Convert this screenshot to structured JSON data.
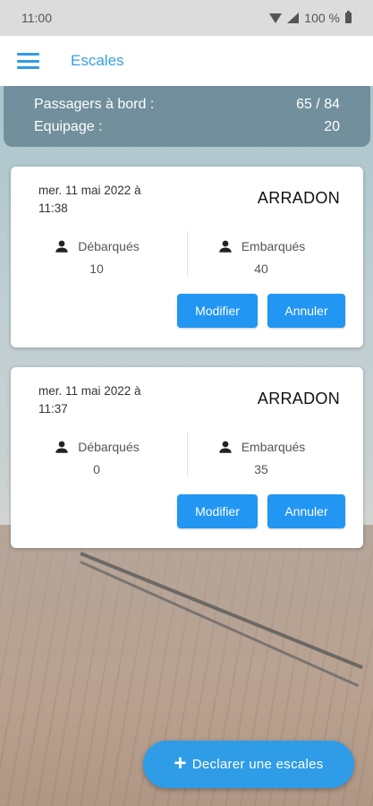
{
  "status_bar": {
    "time": "11:00",
    "battery": "100 %",
    "icons": [
      "wifi-icon",
      "signal-icon",
      "battery-icon"
    ]
  },
  "app_bar": {
    "menu_icon": "hamburger-menu-icon",
    "title": "Escales"
  },
  "summary": {
    "passengers_label": "Passagers à bord :",
    "passengers_value": "65 / 84",
    "crew_label": "Equipage :",
    "crew_value": "20"
  },
  "stops": [
    {
      "date": "mer. 11 mai 2022 à 11:38",
      "place": "ARRADON",
      "disembarked_label": "Débarqués",
      "disembarked_value": "10",
      "embarked_label": "Embarqués",
      "embarked_value": "40",
      "modify_label": "Modifier",
      "cancel_label": "Annuler"
    },
    {
      "date": "mer. 11 mai 2022 à 11:37",
      "place": "ARRADON",
      "disembarked_label": "Débarqués",
      "disembarked_value": "0",
      "embarked_label": "Embarqués",
      "embarked_value": "35",
      "modify_label": "Modifier",
      "cancel_label": "Annuler"
    }
  ],
  "fab": {
    "icon": "plus-icon",
    "label": "Declarer une escales"
  },
  "colors": {
    "accent": "#2196f3",
    "title": "#35a0e6",
    "summary_bg": "#60808e"
  }
}
